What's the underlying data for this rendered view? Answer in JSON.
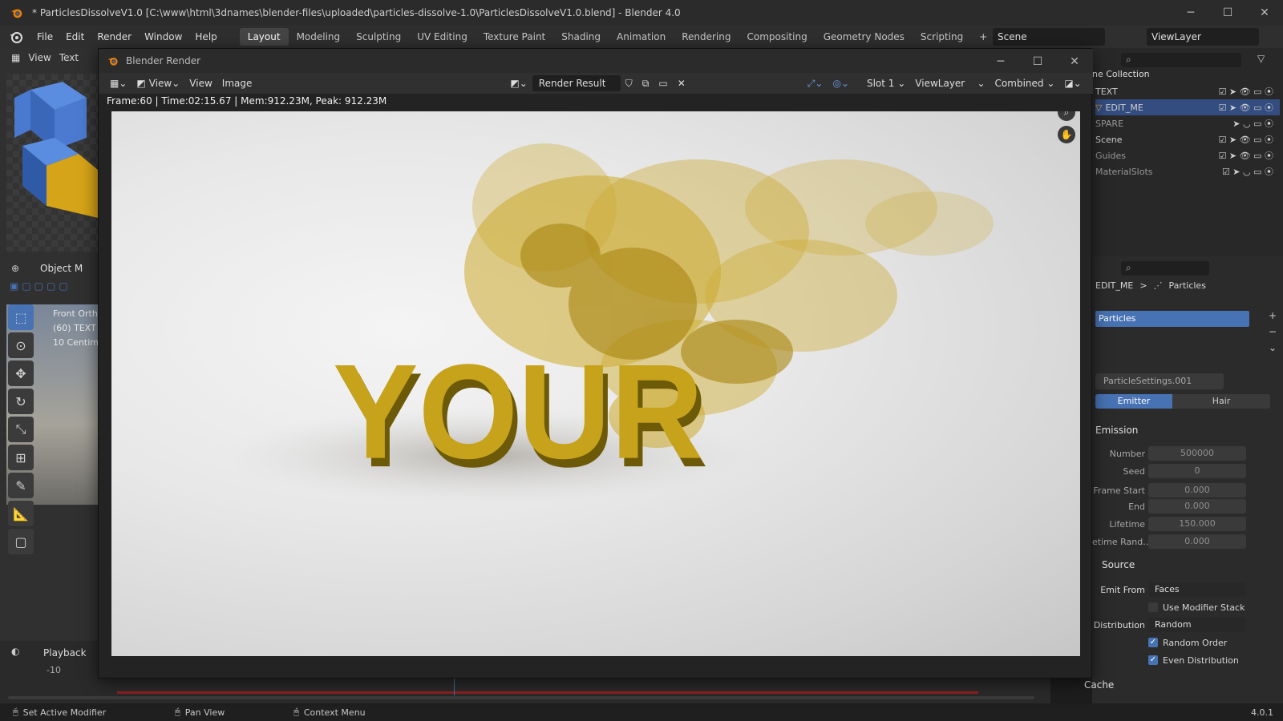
{
  "window": {
    "title": "* ParticlesDissolveV1.0 [C:\\www\\html\\3dnames\\blender-files\\uploaded\\particles-dissolve-1.0\\ParticlesDissolveV1.0.blend] - Blender 4.0",
    "minimize": "─",
    "maximize": "☐",
    "close": "✕"
  },
  "menubar": {
    "items": [
      "File",
      "Edit",
      "Render",
      "Window",
      "Help"
    ],
    "workspaces": [
      "Layout",
      "Modeling",
      "Sculpting",
      "UV Editing",
      "Texture Paint",
      "Shading",
      "Animation",
      "Rendering",
      "Compositing",
      "Geometry Nodes",
      "Scripting"
    ],
    "add_workspace": "+",
    "scene": "Scene",
    "view_layer": "ViewLayer"
  },
  "viewport": {
    "header_items": [
      "View",
      "Text"
    ],
    "mode": "Object M",
    "overlay_lines": [
      "Front Ortho",
      "(60) TEXT",
      "10 Centim"
    ],
    "playback": "Playback",
    "frame_marker": "-10"
  },
  "render_window": {
    "title": "Blender Render",
    "header": {
      "view_menu": "View",
      "view2": "View",
      "image": "Image",
      "image_name": "Render Result",
      "slot": "Slot 1",
      "view_layer": "ViewLayer",
      "pass": "Combined"
    },
    "info": "Frame:60 | Time:02:15.67 | Mem:912.23M, Peak: 912.23M",
    "render_text": "YOUR"
  },
  "outliner": {
    "title": "ne Collection",
    "rows": [
      {
        "name": "TEXT"
      },
      {
        "name": "EDIT_ME",
        "selected": true
      },
      {
        "name": "SPARE"
      },
      {
        "name": "Scene"
      },
      {
        "name": "Guides"
      },
      {
        "name": "MaterialSlots"
      }
    ]
  },
  "properties": {
    "breadcrumb_object": "EDIT_ME",
    "breadcrumb_sep": ">",
    "breadcrumb_tab": "Particles",
    "particle_system": "Particles",
    "settings_name": "ParticleSettings.001",
    "type_tabs": [
      "Emitter",
      "Hair"
    ],
    "emission_title": "Emission",
    "fields": [
      {
        "label": "Number",
        "value": "500000"
      },
      {
        "label": "Seed",
        "value": "0"
      },
      {
        "label": "Frame Start",
        "value": "0.000"
      },
      {
        "label": "End",
        "value": "0.000"
      },
      {
        "label": "Lifetime",
        "value": "150.000"
      },
      {
        "label": "etime Rand...",
        "value": "0.000"
      }
    ],
    "source_title": "Source",
    "emit_from_label": "Emit From",
    "emit_from": "Faces",
    "use_modifier_stack": "Use Modifier Stack",
    "distribution_label": "Distribution",
    "distribution": "Random",
    "random_order": "Random Order",
    "even_distribution": "Even Distribution",
    "cache_title": "Cache"
  },
  "statusbar": {
    "items": [
      "Set Active Modifier",
      "Pan View",
      "Context Menu"
    ],
    "version": "4.0.1"
  }
}
